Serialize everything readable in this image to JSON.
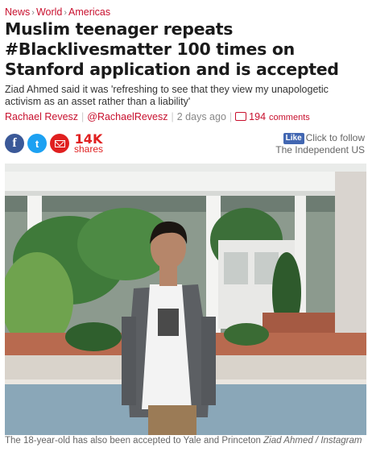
{
  "breadcrumb": {
    "items": [
      "News",
      "World",
      "Americas"
    ]
  },
  "article": {
    "headline": "Muslim teenager repeats #Blacklivesmatter 100 times on Stanford application and is accepted",
    "standfirst": "Ziad Ahmed said it was 'refreshing to see that they view my unapologetic activism as an asset rather than a liability'",
    "author": "Rachael Revesz",
    "author_handle": "@RachaelRevesz",
    "time_ago": "2 days ago",
    "comment_count": "194",
    "comment_label": "comments"
  },
  "share": {
    "facebook_icon": "f",
    "twitter_icon": "t",
    "share_count": "14K",
    "share_label": "shares"
  },
  "follow": {
    "like_label": "Like",
    "text": "Click to follow",
    "publication": "The Independent US"
  },
  "image": {
    "caption": "The 18-year-old has also been accepted to Yale and Princeton",
    "credit": "Ziad Ahmed / Instagram"
  },
  "colors": {
    "accent": "#c8102e",
    "facebook": "#3b5998",
    "twitter": "#1da1f2",
    "email": "#e02020"
  }
}
